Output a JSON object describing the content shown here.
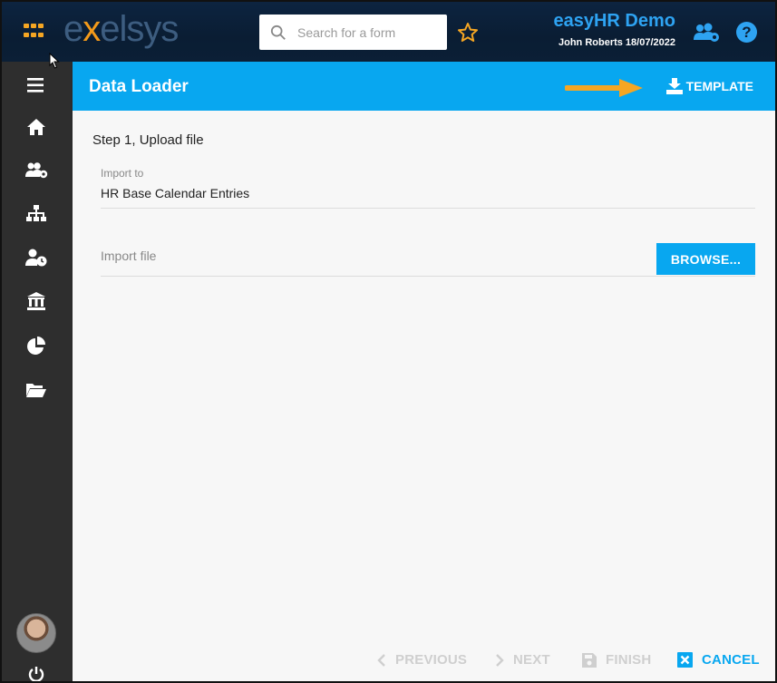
{
  "topbar": {
    "logo_prefix": "e",
    "logo_x": "x",
    "logo_suffix": "elsys",
    "search_placeholder": "Search for a form",
    "tenant_name": "easyHR Demo",
    "user_line": "John Roberts 18/07/2022",
    "help_label": "?"
  },
  "sidebar": {
    "items": [
      {
        "icon": "menu-icon"
      },
      {
        "icon": "home-icon"
      },
      {
        "icon": "people-settings-icon"
      },
      {
        "icon": "org-chart-icon"
      },
      {
        "icon": "user-clock-icon"
      },
      {
        "icon": "bank-icon"
      },
      {
        "icon": "pie-chart-icon"
      },
      {
        "icon": "folder-open-icon"
      }
    ]
  },
  "page": {
    "title": "Data Loader",
    "template_label": "TEMPLATE",
    "step_label": "Step 1, Upload file",
    "import_to_label": "Import to",
    "import_to_value": "HR Base Calendar Entries",
    "import_file_label": "Import file",
    "browse_label": "BROWSE..."
  },
  "footer": {
    "previous_label": "PREVIOUS",
    "next_label": "NEXT",
    "finish_label": "FINISH",
    "cancel_label": "CANCEL"
  },
  "colors": {
    "accent": "#08a7f0",
    "brand_orange": "#f39a1a",
    "topbar": "#0b1f36",
    "sidebar": "#2e2e2e"
  }
}
